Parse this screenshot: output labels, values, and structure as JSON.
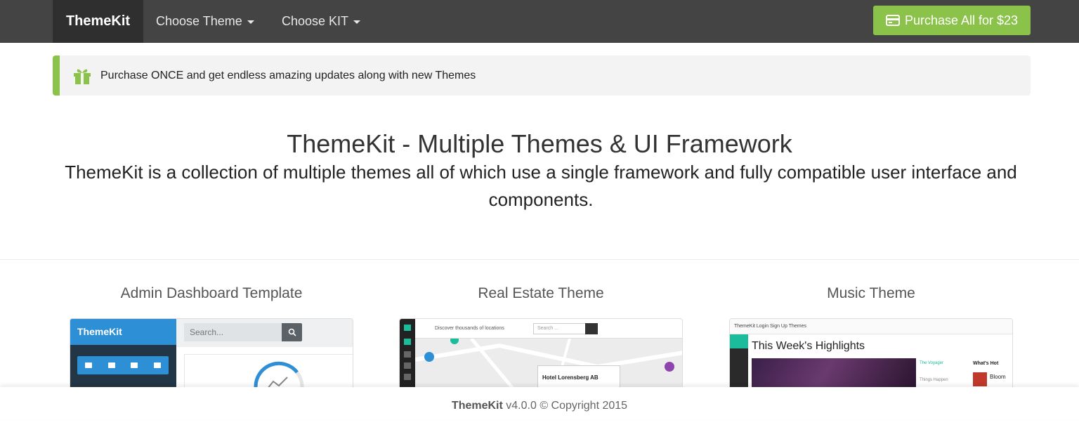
{
  "navbar": {
    "brand": "ThemeKit",
    "items": [
      {
        "label": "Choose Theme"
      },
      {
        "label": "Choose KIT"
      }
    ],
    "purchase_label": "Purchase All for $23"
  },
  "alert": {
    "icon": "gift-icon",
    "text": "Purchase ONCE and get endless amazing updates along with new Themes"
  },
  "hero": {
    "title": "ThemeKit - Multiple Themes & UI Framework",
    "subtitle": "ThemeKit is a collection of multiple themes all of which use a single framework and fully compatible user interface and components."
  },
  "themes": [
    {
      "title": "Admin Dashboard Template",
      "preview": {
        "brand": "ThemeKit",
        "search_placeholder": "Search..."
      }
    },
    {
      "title": "Real Estate Theme",
      "preview": {
        "search_hint": "Discover thousands of locations",
        "search_placeholder": "Search ...",
        "card_title": "Hotel Lorensberg AB"
      }
    },
    {
      "title": "Music Theme",
      "preview": {
        "nav": "ThemeKit   Login   Sign Up   Themes",
        "heading": "This Week's Highlights",
        "list": [
          "The Voyager",
          "Things Happen"
        ],
        "hot": "What's Hot",
        "hot_item": "Bloom"
      }
    }
  ],
  "footer": {
    "brand": "ThemeKit",
    "text": "v4.0.0 © Copyright 2015"
  },
  "colors": {
    "navbar": "#444444",
    "accent": "#8bc34a",
    "admin_blue": "#2d8fd5"
  }
}
